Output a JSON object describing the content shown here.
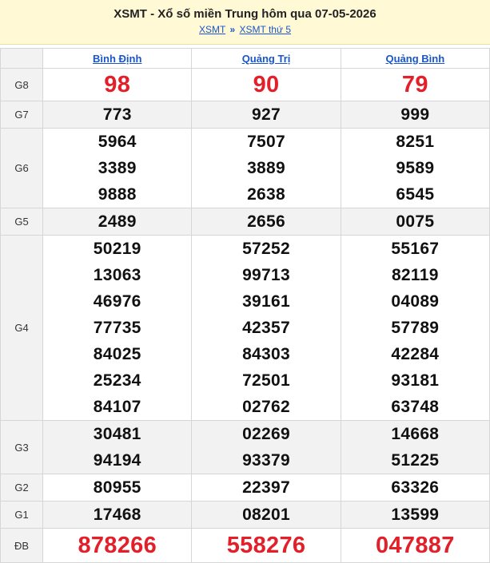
{
  "header": {
    "title": "XSMT - Xổ số miền Trung hôm qua 07-05-2026",
    "crumb_1": "XSMT",
    "crumb_sep": "»",
    "crumb_2": "XSMT thứ 5"
  },
  "provinces": [
    "Bình Định",
    "Quảng Trị",
    "Quảng Bình"
  ],
  "prizes": [
    {
      "label": "G8",
      "style": "big",
      "values": [
        [
          "98"
        ],
        [
          "90"
        ],
        [
          "79"
        ]
      ]
    },
    {
      "label": "G7",
      "style": "normal",
      "values": [
        [
          "773"
        ],
        [
          "927"
        ],
        [
          "999"
        ]
      ]
    },
    {
      "label": "G6",
      "style": "normal",
      "values": [
        [
          "5964",
          "3389",
          "9888"
        ],
        [
          "7507",
          "3889",
          "2638"
        ],
        [
          "8251",
          "9589",
          "6545"
        ]
      ]
    },
    {
      "label": "G5",
      "style": "normal",
      "values": [
        [
          "2489"
        ],
        [
          "2656"
        ],
        [
          "0075"
        ]
      ]
    },
    {
      "label": "G4",
      "style": "normal",
      "values": [
        [
          "50219",
          "13063",
          "46976",
          "77735",
          "84025",
          "25234",
          "84107"
        ],
        [
          "57252",
          "99713",
          "39161",
          "42357",
          "84303",
          "72501",
          "02762"
        ],
        [
          "55167",
          "82119",
          "04089",
          "57789",
          "42284",
          "93181",
          "63748"
        ]
      ]
    },
    {
      "label": "G3",
      "style": "normal",
      "values": [
        [
          "30481",
          "94194"
        ],
        [
          "02269",
          "93379"
        ],
        [
          "14668",
          "51225"
        ]
      ]
    },
    {
      "label": "G2",
      "style": "normal",
      "values": [
        [
          "80955"
        ],
        [
          "22397"
        ],
        [
          "63326"
        ]
      ]
    },
    {
      "label": "G1",
      "style": "normal",
      "values": [
        [
          "17468"
        ],
        [
          "08201"
        ],
        [
          "13599"
        ]
      ]
    },
    {
      "label": "ĐB",
      "style": "db",
      "values": [
        [
          "878266"
        ],
        [
          "558276"
        ],
        [
          "047887"
        ]
      ]
    }
  ],
  "colors": {
    "accent_red": "#e3202a",
    "link_blue": "#1a55c9",
    "header_bg": "#fff9d6",
    "shade": "#f2f2f2"
  }
}
